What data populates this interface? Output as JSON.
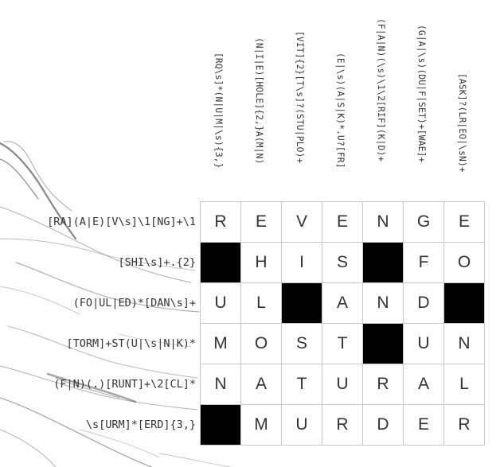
{
  "puzzle": {
    "column_clues": [
      "[RQ\\s]*(N|U|M|\\s){3,}",
      "(N|I|E)[HOLE]{2,}A(M|N)",
      "[VIT]{2}[T\\s]?(STU|PLO)+",
      "(E|\\s)(A|S|K)*.U?[FR]",
      "(F|A|N)(\\s)\\1\\2[RIF](K|D)+",
      "(G|A|\\s)(DU|F|SET)+[WAE]+",
      "[ASK]?(LR|EO|\\sN)+"
    ],
    "row_clues": [
      "[RA](A|E)[V\\s]\\1[NG]+\\1",
      "[SHI\\s]+.{2}",
      "(FO|UL|ED)*[DAN\\s]+",
      "[TORM]+ST(U|\\s|N|K)*",
      "(F|N)(.)[RUNT]+\\2[CL]*",
      "\\s[URM]*[ERD]{3,}"
    ],
    "grid": [
      [
        "R",
        "E",
        "V",
        "E",
        "N",
        "G",
        "E"
      ],
      [
        " ",
        "H",
        "I",
        "S",
        " ",
        "F",
        "O"
      ],
      [
        "U",
        "L",
        " ",
        "A",
        "N",
        "D",
        " "
      ],
      [
        "M",
        "O",
        "S",
        "T",
        " ",
        "U",
        "N"
      ],
      [
        "N",
        "A",
        "T",
        "U",
        "R",
        "A",
        "L"
      ],
      [
        " ",
        "M",
        "U",
        "R",
        "D",
        "E",
        "R"
      ]
    ],
    "colors": {
      "blocked": "#000000",
      "grid_line": "#c8c8c8",
      "text": "#333333"
    }
  }
}
